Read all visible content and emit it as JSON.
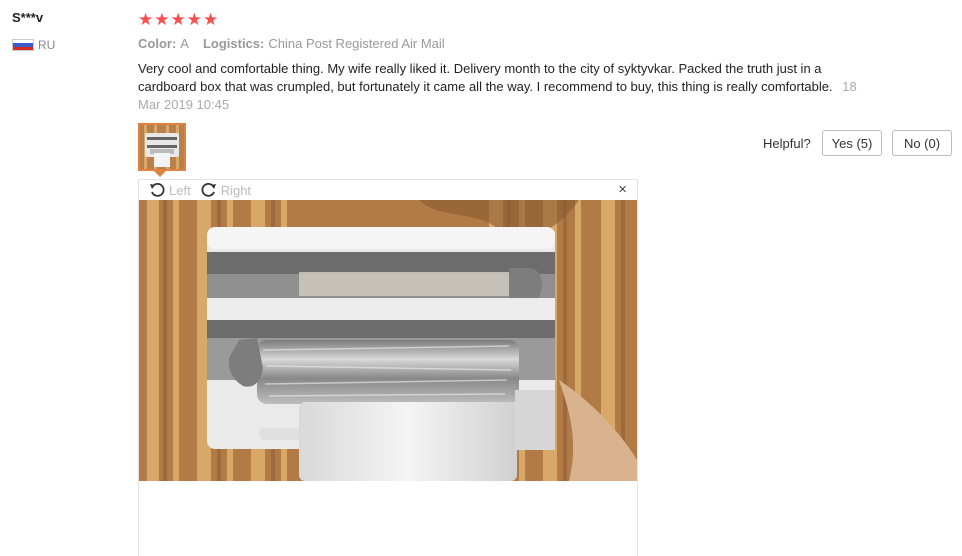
{
  "reviewer": {
    "name": "S***v",
    "country": "RU"
  },
  "rating": {
    "stars": 5,
    "max": 5,
    "color": "#f5504d"
  },
  "meta": {
    "color_label": "Color:",
    "color_value": "A",
    "logistics_label": "Logistics:",
    "logistics_value": "China Post Registered Air Mail"
  },
  "review": {
    "text": "Very cool and comfortable thing. My wife really liked it. Delivery month to the city of syktyvkar. Packed the truth just in a cardboard box that was crumpled, but fortunately it came all the way. I recommend to buy, this thing is really comfortable.",
    "date": "18 Mar 2019 10:45"
  },
  "helpful": {
    "label": "Helpful?",
    "yes_label": "Yes (5)",
    "no_label": "No (0)"
  },
  "viewer": {
    "rotate_left": "Left",
    "rotate_right": "Right",
    "close": "×"
  },
  "icons": {
    "flag": "russia-flag-icon",
    "rotate_left": "rotate-left-icon",
    "rotate_right": "rotate-right-icon",
    "close": "close-icon",
    "star": "star-icon"
  }
}
